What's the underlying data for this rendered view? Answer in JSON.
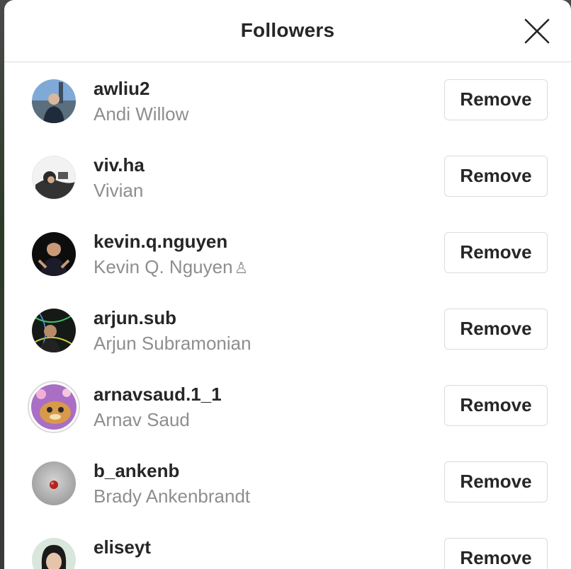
{
  "dialog": {
    "title": "Followers",
    "close_icon": "close-icon"
  },
  "followers": [
    {
      "username": "awliu2",
      "full_name": "Andi Willow",
      "action": "Remove"
    },
    {
      "username": "viv.ha",
      "full_name": "Vivian",
      "action": "Remove"
    },
    {
      "username": "kevin.q.nguyen",
      "full_name": "Kevin Q. Nguyen",
      "action": "Remove",
      "badge_icon": "chess-pawn-icon",
      "badge_glyph": "♙"
    },
    {
      "username": "arjun.sub",
      "full_name": "Arjun Subramonian",
      "action": "Remove"
    },
    {
      "username": "arnavsaud.1_1",
      "full_name": "Arnav Saud",
      "action": "Remove"
    },
    {
      "username": "b_ankenb",
      "full_name": "Brady Ankenbrandt",
      "action": "Remove"
    },
    {
      "username": "eliseyt",
      "full_name": "",
      "action": "Remove"
    }
  ],
  "colors": {
    "primary_text": "#262626",
    "secondary_text": "#8e8e8e",
    "border": "#dbdbdb",
    "background": "#ffffff"
  }
}
